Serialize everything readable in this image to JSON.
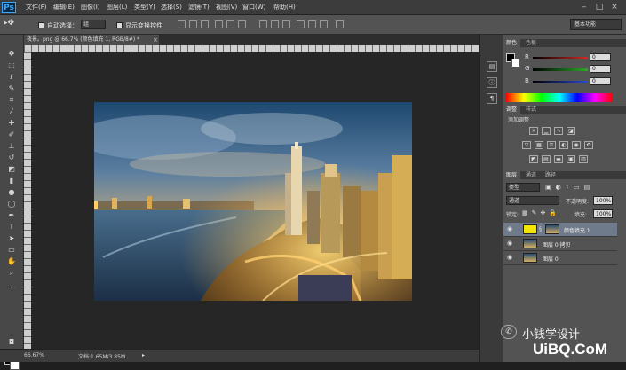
{
  "app": {
    "logo": "Ps"
  },
  "menu": [
    "文件(F)",
    "编辑(E)",
    "图像(I)",
    "图层(L)",
    "类型(Y)",
    "选择(S)",
    "滤镜(T)",
    "视图(V)",
    "窗口(W)",
    "帮助(H)"
  ],
  "window_controls": [
    "–",
    "□",
    "×"
  ],
  "options": {
    "auto_select_label": "自动选择：",
    "auto_select_value": "组",
    "show_transform_label": "显示变换控件",
    "workspace": "基本功能"
  },
  "document": {
    "tab_title": "夜景。png @ 66.7% (颜色填充 1, RGB/8#) *",
    "close": "×"
  },
  "status": {
    "zoom": "66.67%",
    "doc_size": "文档:1.65M/3.85M"
  },
  "color_panel": {
    "tabs": [
      "颜色",
      "色板"
    ],
    "channels": [
      {
        "label": "R",
        "value": "0",
        "color": "#d02a2a"
      },
      {
        "label": "G",
        "value": "0",
        "color": "#2aaa2a"
      },
      {
        "label": "B",
        "value": "0",
        "color": "#2a4ad0"
      }
    ]
  },
  "adjust_panel": {
    "tabs": [
      "调整",
      "样式"
    ],
    "title": "添加调整"
  },
  "layers_panel": {
    "tabs": [
      "图层",
      "通道",
      "路径"
    ],
    "kind_label": "类型",
    "blend_mode": "通道",
    "opacity_label": "不透明度:",
    "opacity_value": "100%",
    "lock_label": "锁定:",
    "fill_label": "填充:",
    "fill_value": "100%",
    "layers": [
      {
        "name": "颜色填充 1",
        "selected": true
      },
      {
        "name": "图层 0 拷贝",
        "selected": false
      },
      {
        "name": "图层 0",
        "selected": false
      }
    ]
  },
  "watermark": {
    "text": "小钱学设计",
    "site": "UiBQ.CoM"
  },
  "colors": {
    "accent": "#37a8ff",
    "selected_layer": "#6f7a8a",
    "fill_swatch": "#f5e600"
  }
}
